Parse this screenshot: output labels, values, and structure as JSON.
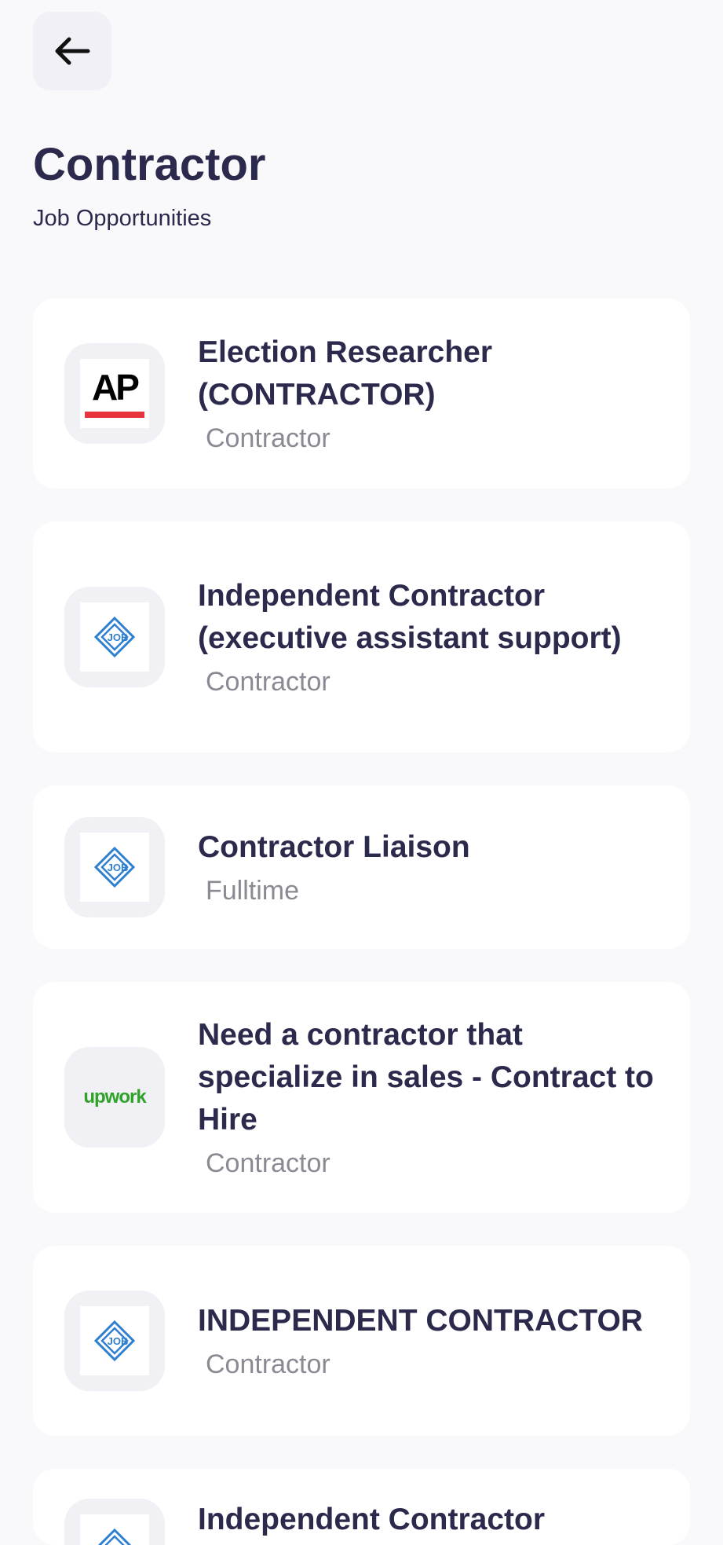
{
  "header": {
    "title": "Contractor",
    "subtitle": "Job Opportunities"
  },
  "jobs": [
    {
      "title": "Election Researcher (CONTRACTOR)",
      "type": "Contractor",
      "logo": "ap-logo"
    },
    {
      "title": "Independent Contractor (executive assistant support)",
      "type": "Contractor",
      "logo": "job-logo"
    },
    {
      "title": "Contractor Liaison",
      "type": "Fulltime",
      "logo": "job-logo"
    },
    {
      "title": "Need a contractor that specialize in sales  - Contract to Hire",
      "type": "Contractor",
      "logo": "upwork-logo",
      "logo_text": "upwork"
    },
    {
      "title": "INDEPENDENT CONTRACTOR",
      "type": "Contractor",
      "logo": "job-logo"
    },
    {
      "title": "Independent Contractor",
      "type": "",
      "logo": "job-logo"
    }
  ],
  "logos": {
    "ap_text": "AP",
    "job_text": "JOB",
    "upwork_text": "upwork"
  },
  "colors": {
    "background": "#f9f8fb",
    "card": "#ffffff",
    "text_primary": "#2b2a4c",
    "text_secondary": "#8a8a94",
    "ap_red": "#e8353b",
    "job_blue": "#2e7fd0",
    "upwork_green": "#2ea32a"
  }
}
